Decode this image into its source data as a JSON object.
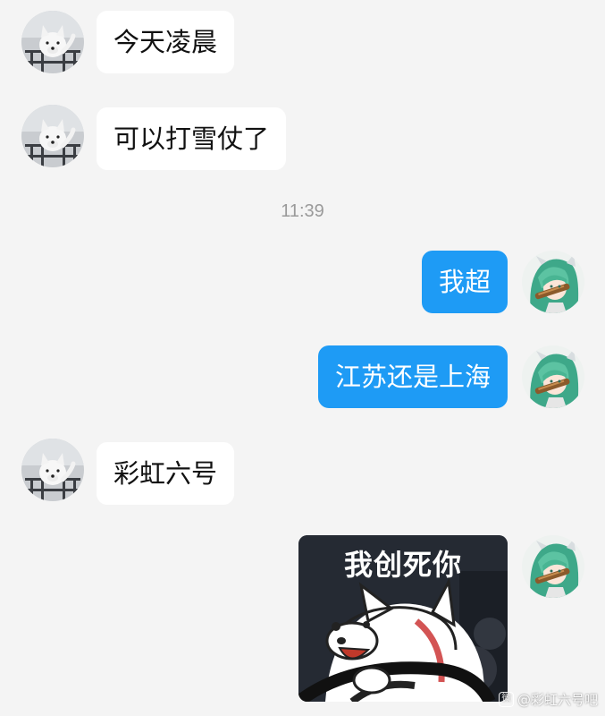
{
  "messages": [
    {
      "side": "in",
      "text": "今天凌晨"
    },
    {
      "side": "in",
      "text": "可以打雪仗了"
    },
    {
      "side": "out",
      "text": "我超"
    },
    {
      "side": "out",
      "text": "江苏还是上海"
    },
    {
      "side": "in",
      "text": "彩虹六号"
    },
    {
      "side": "out",
      "sticker_caption": "我创死你"
    }
  ],
  "timestamp": "11:39",
  "watermark": {
    "logo_char": "微",
    "text": "@彩虹六号吧"
  },
  "avatars": {
    "incoming": "dog-avatar-icon",
    "outgoing": "anime-girl-avatar-icon"
  },
  "colors": {
    "background": "#f4f4f4",
    "incoming_bubble": "#ffffff",
    "outgoing_bubble": "#1e9bf5",
    "timestamp": "#9a9a9a"
  }
}
